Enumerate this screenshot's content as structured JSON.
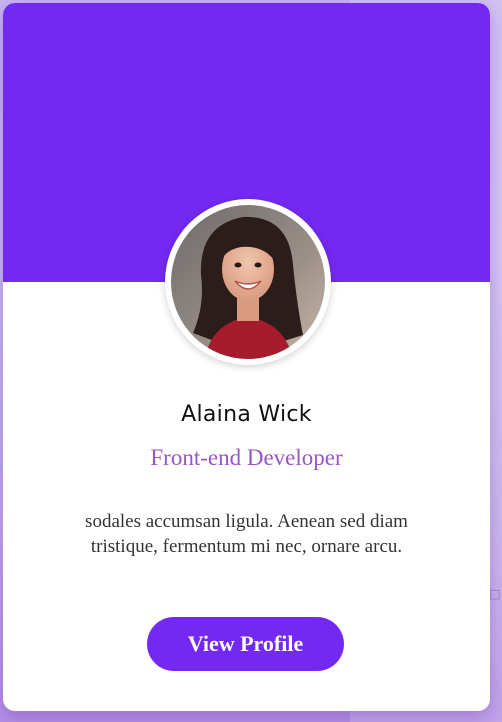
{
  "colors": {
    "accent": "#7429f2",
    "role_text": "#9a55c4",
    "button": "#7429f2"
  },
  "profile": {
    "name": "Alaina Wick",
    "role": "Front-end Developer",
    "bio": "sodales accumsan ligula. Aenean sed diam tristique, fermentum mi nec, ornare arcu.",
    "avatar_icon": "profile-photo"
  },
  "actions": {
    "view_profile_label": "View Profile"
  }
}
